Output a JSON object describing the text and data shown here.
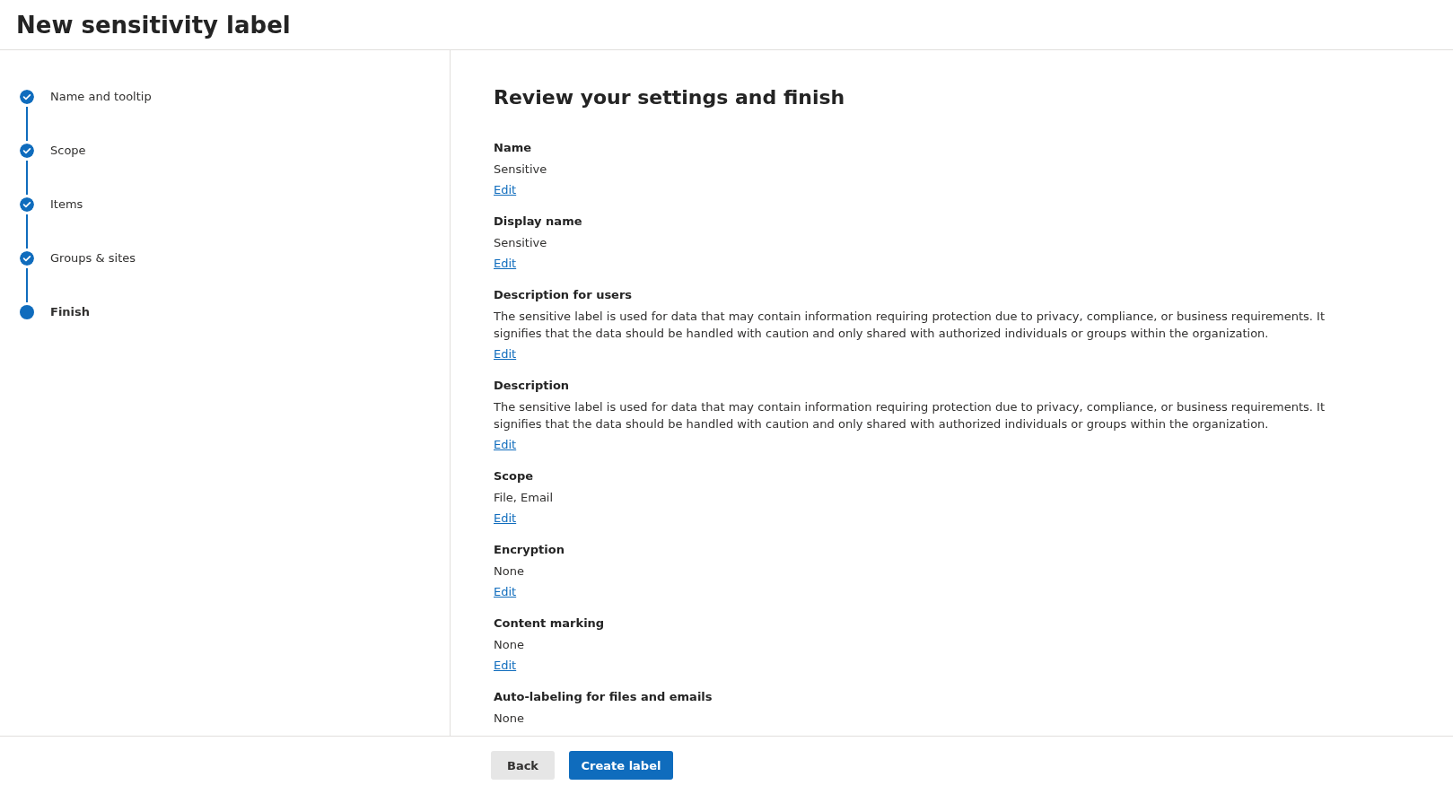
{
  "window": {
    "title": "New sensitivity label"
  },
  "steps": [
    {
      "label": "Name and tooltip",
      "completed": true,
      "selected": false
    },
    {
      "label": "Scope",
      "completed": true,
      "selected": false
    },
    {
      "label": "Items",
      "completed": true,
      "selected": false
    },
    {
      "label": "Groups & sites",
      "completed": true,
      "selected": false
    },
    {
      "label": "Finish",
      "completed": false,
      "selected": true
    }
  ],
  "review": {
    "heading": "Review your settings and finish",
    "sections": [
      {
        "label": "Name",
        "value": "Sensitive",
        "link": "Edit"
      },
      {
        "label": "Display name",
        "value": "Sensitive",
        "link": "Edit"
      },
      {
        "label": "Description for users",
        "value": "The sensitive label is used for data that may contain information requiring protection due to privacy, compliance, or business requirements. It signifies that the data should be handled with caution and only shared with authorized individuals or groups within the organization.",
        "link": "Edit"
      },
      {
        "label": "Description",
        "value": "The sensitive label is used for data that may contain information requiring protection due to privacy, compliance, or business requirements. It signifies that the data should be handled with caution and only shared with authorized individuals or groups within the organization.",
        "link": "Edit"
      },
      {
        "label": "Scope",
        "value": "File, Email",
        "link": "Edit"
      },
      {
        "label": "Encryption",
        "value": "None",
        "link": "Edit"
      },
      {
        "label": "Content marking",
        "value": "None",
        "link": "Edit"
      },
      {
        "label": "Auto-labeling for files and emails",
        "value": "None"
      }
    ]
  },
  "footer": {
    "buttons": [
      {
        "label": "Back",
        "kind": "secondary"
      },
      {
        "label": "Create label",
        "kind": "primary"
      }
    ]
  }
}
